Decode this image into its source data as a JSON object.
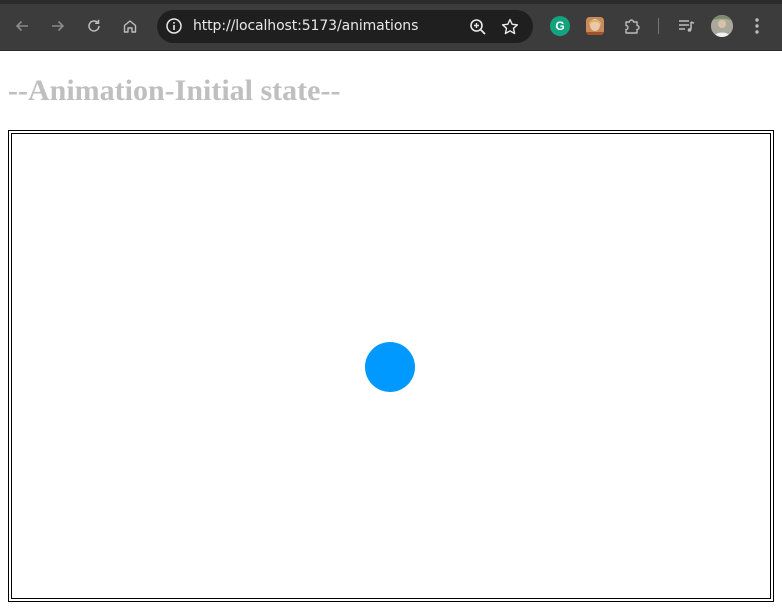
{
  "browser": {
    "url": "http://localhost:5173/animations",
    "extension_g_letter": "G",
    "icons": {
      "back": "back-arrow-icon",
      "forward": "forward-arrow-icon",
      "reload": "reload-icon",
      "home": "home-icon",
      "site_info": "info-icon",
      "zoom": "zoom-icon",
      "bookmark": "star-icon",
      "extensions": "puzzle-icon",
      "media": "media-control-icon",
      "menu": "kebab-menu-icon"
    }
  },
  "page": {
    "title": "--Animation-Initial state--"
  },
  "colors": {
    "chrome_bg": "#3c3c3c",
    "omnibox_bg": "#1f1f1f",
    "title_color": "#bfbfbf",
    "ball_color": "#0099ff",
    "grammarly_green": "#14a37f"
  }
}
